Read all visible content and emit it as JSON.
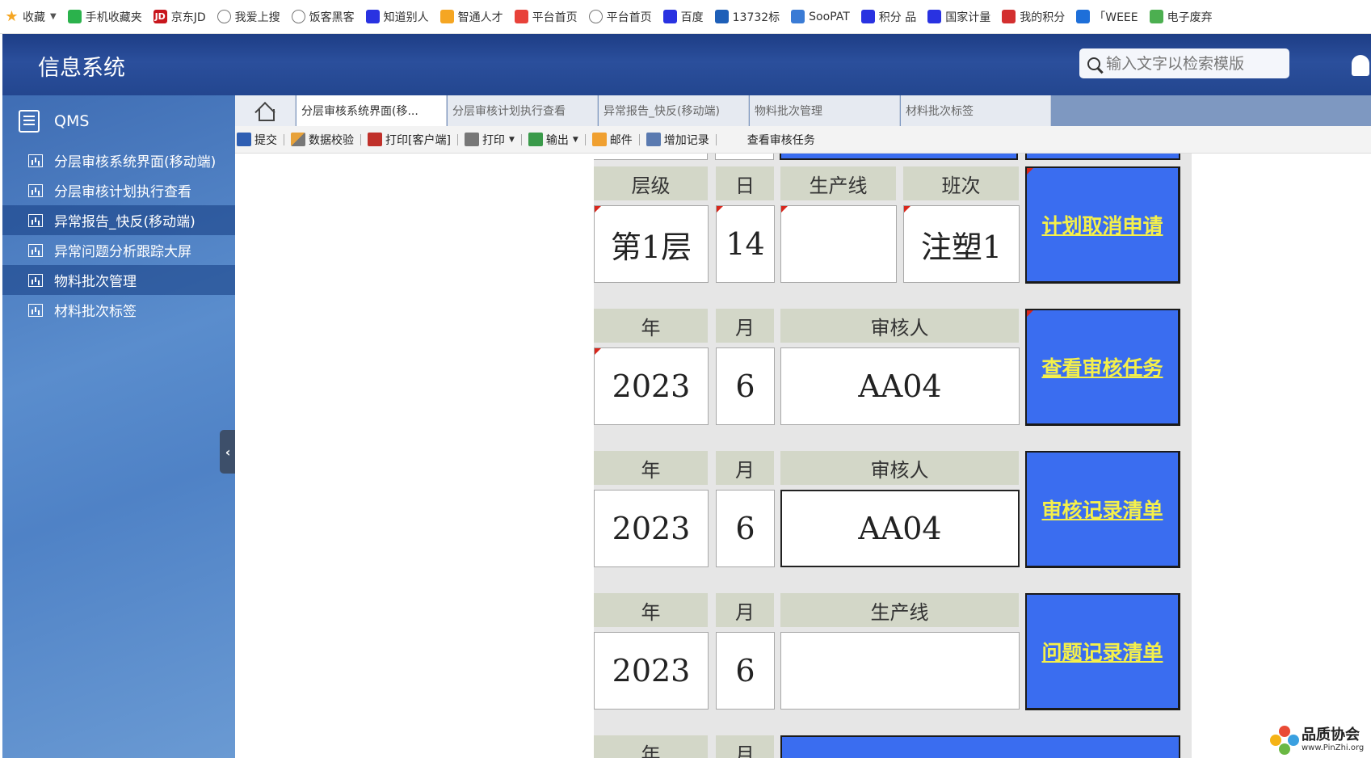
{
  "bookmarks": [
    {
      "label": "收藏",
      "icon": "star-icon",
      "color": "#f5a623",
      "dropdown": true
    },
    {
      "label": "手机收藏夹",
      "icon": "phone-icon",
      "color": "#2bb24c"
    },
    {
      "label": "京东JD",
      "icon": "jd-icon",
      "color": "#c8161d",
      "glyph": "JD"
    },
    {
      "label": "我爱上搜",
      "icon": "globe-icon",
      "color": "#777777"
    },
    {
      "label": "饭客黑客",
      "icon": "globe-icon",
      "color": "#777777"
    },
    {
      "label": "知道别人",
      "icon": "paw-icon",
      "color": "#2932e1"
    },
    {
      "label": "智通人才",
      "icon": "zhitong-icon",
      "color": "#f5a623"
    },
    {
      "label": "平台首页",
      "icon": "platform-icon",
      "color": "#e8423a"
    },
    {
      "label": "平台首页",
      "icon": "globe-icon",
      "color": "#777777"
    },
    {
      "label": "百度",
      "icon": "baidu-paw-icon",
      "color": "#2932e1"
    },
    {
      "label": "13732标",
      "icon": "x-icon",
      "color": "#1e5fb8"
    },
    {
      "label": "SooPAT",
      "icon": "soopat-icon",
      "color": "#3a7bd5"
    },
    {
      "label": "积分 品",
      "icon": "points-icon",
      "color": "#2932e1"
    },
    {
      "label": "国家计量",
      "icon": "points-icon",
      "color": "#2932e1"
    },
    {
      "label": "我的积分",
      "icon": "euro-icon",
      "color": "#d32f2f"
    },
    {
      "label": "「WEEE",
      "icon": "person-icon",
      "color": "#1e6fd9"
    },
    {
      "label": "电子废弃",
      "icon": "library-icon",
      "color": "#4caf50"
    }
  ],
  "header": {
    "title": "信息系统",
    "search_placeholder": "输入文字以检索模版"
  },
  "sidebar": {
    "title": "QMS",
    "items": [
      {
        "label": "分层审核系统界面(移动端)",
        "active": false
      },
      {
        "label": "分层审核计划执行查看",
        "active": false
      },
      {
        "label": "异常报告_快反(移动端)",
        "active": true
      },
      {
        "label": "异常问题分析跟踪大屏",
        "active": false
      },
      {
        "label": "物料批次管理",
        "active": true
      },
      {
        "label": "材料批次标签",
        "active": false
      }
    ]
  },
  "tabs": [
    {
      "label": "分层审核系统界面(移...",
      "active": true
    },
    {
      "label": "分层审核计划执行查看",
      "active": false
    },
    {
      "label": "异常报告_快反(移动端)",
      "active": false
    },
    {
      "label": "物料批次管理",
      "active": false
    },
    {
      "label": "材料批次标签",
      "active": false
    }
  ],
  "toolbar": {
    "submit": "提交",
    "validate": "数据校验",
    "print_client": "打印[客户端]",
    "print": "打印",
    "export": "输出",
    "mail": "邮件",
    "add_record": "增加记录",
    "view_tasks": "查看审核任务"
  },
  "form": {
    "row1": {
      "headers": [
        "层级",
        "日",
        "生产线",
        "班次"
      ],
      "values": [
        "第1层",
        "14",
        "",
        "注塑1"
      ],
      "button": "计划取消申请"
    },
    "row2": {
      "headers": [
        "年",
        "月",
        "审核人"
      ],
      "values": [
        "2023",
        "6",
        "AA04"
      ],
      "button": "查看审核任务"
    },
    "row3": {
      "headers": [
        "年",
        "月",
        "审核人"
      ],
      "values": [
        "2023",
        "6",
        "AA04"
      ],
      "button": "审核记录清单"
    },
    "row4": {
      "headers": [
        "年",
        "月",
        "生产线"
      ],
      "values": [
        "2023",
        "6",
        ""
      ],
      "button": "问题记录清单"
    },
    "row5": {
      "headers": [
        "年",
        "月"
      ]
    }
  },
  "watermark": {
    "title": "品质协会",
    "url": "www.PinZhi.org"
  }
}
